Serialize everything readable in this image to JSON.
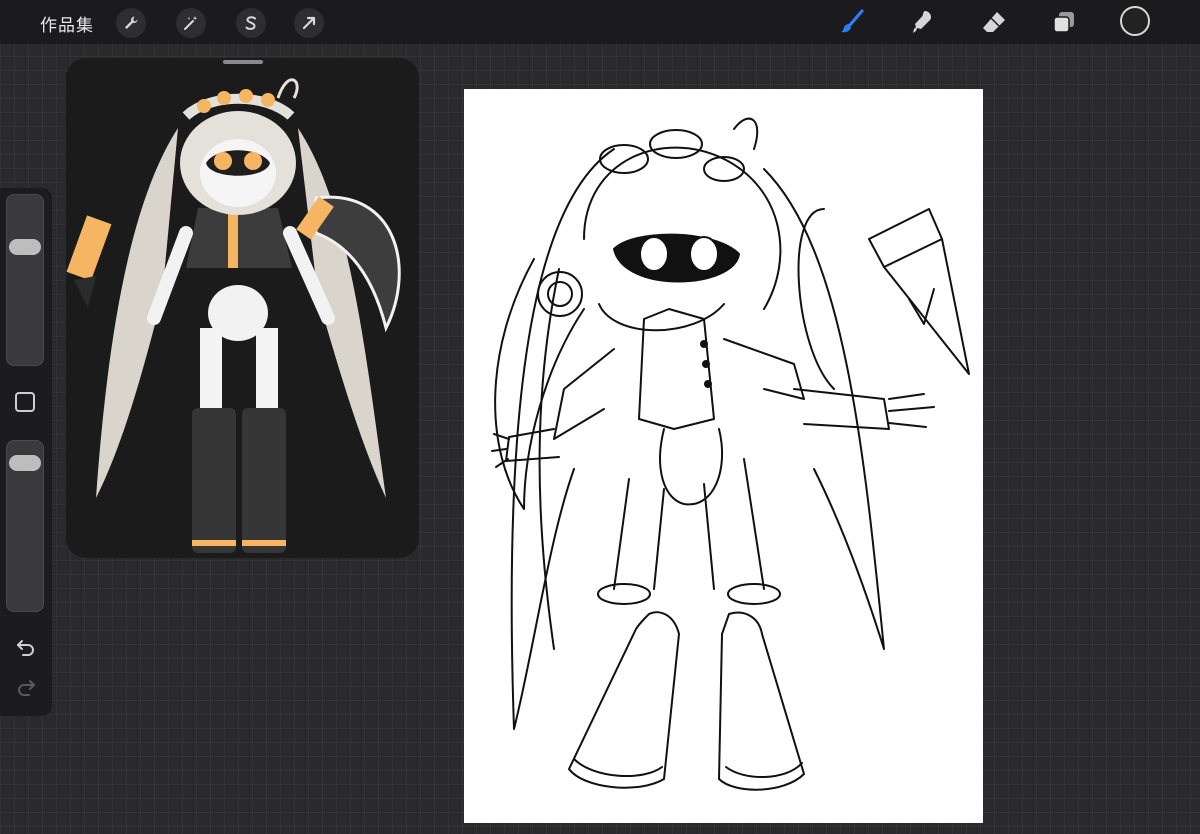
{
  "topbar": {
    "gallery_label": "作品集",
    "left_icons": [
      "wrench-icon",
      "magic-wand-icon",
      "selection-s-icon",
      "arrow-transform-icon"
    ],
    "right_tools": [
      "brush-icon",
      "smudge-icon",
      "eraser-icon",
      "layers-icon"
    ],
    "active_tool": "brush-icon",
    "accent_color": "#2f7cf6",
    "current_color": "#222222"
  },
  "sidebar": {
    "brush_size_fraction": 0.72,
    "opacity_fraction": 0.92,
    "icons": [
      "modify-square-icon",
      "undo-icon",
      "redo-icon"
    ]
  },
  "reference": {
    "background": "#1b1b1c",
    "accent_orange": "#f6b562"
  },
  "canvas": {
    "background": "#ffffff",
    "line_color": "#111111"
  }
}
